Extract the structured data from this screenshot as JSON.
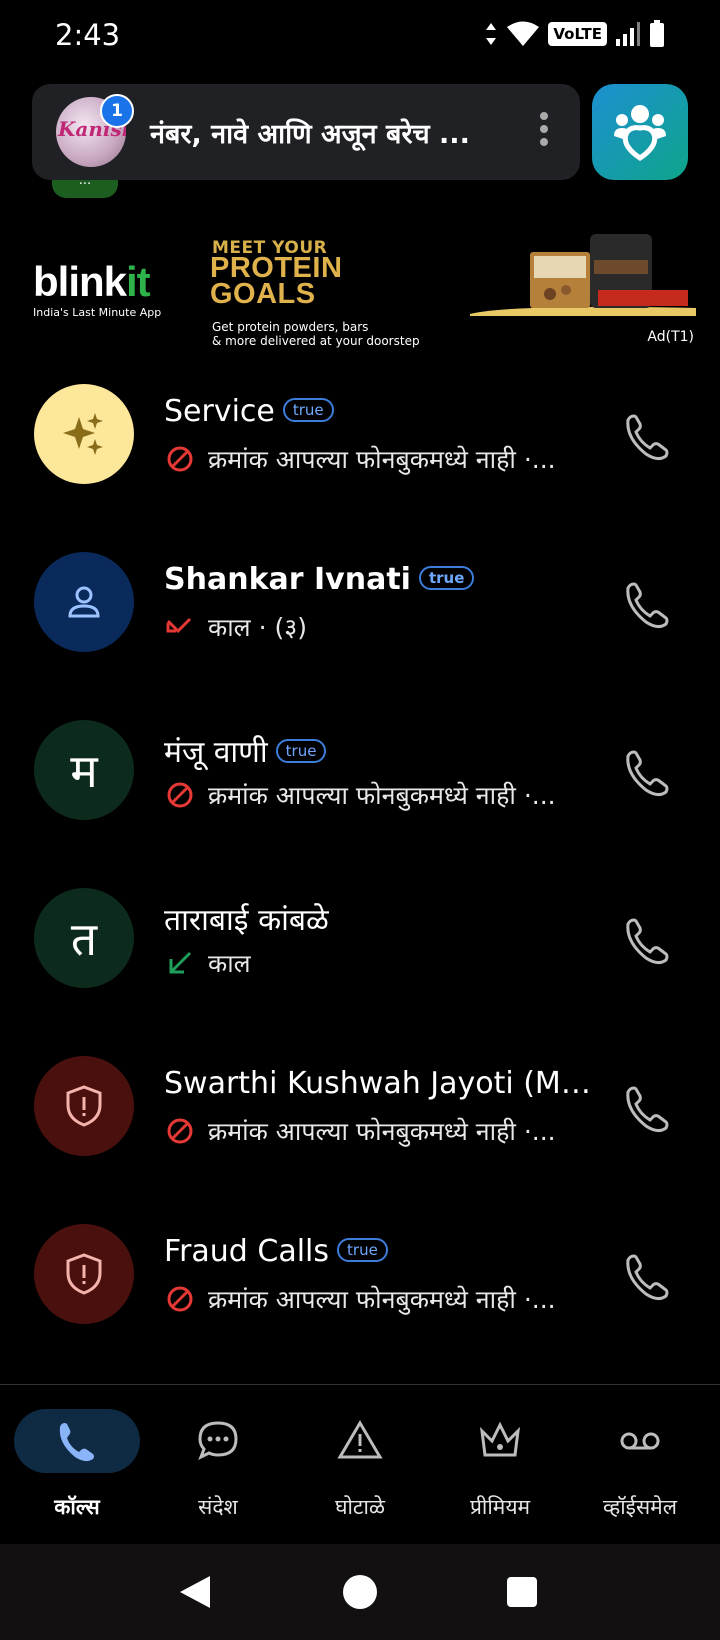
{
  "status": {
    "time": "2:43",
    "volte": "VoLTE"
  },
  "search": {
    "text": "नंबर, नावे आणि अजून बरेच ...",
    "avatar_text": "Kanishka",
    "notification_count": "1"
  },
  "ad": {
    "brand": "blink",
    "brand_suffix": "it",
    "tagline": "India's Last Minute App",
    "headline_small": "MEET YOUR",
    "headline_1": "PROTEIN",
    "headline_2": "GOALS",
    "sub_1": "Get protein powders, bars",
    "sub_2": "& more delivered at your doorstep",
    "label": "Ad(T1)"
  },
  "calls": [
    {
      "name": "Service",
      "badge": "true",
      "sub": "क्रमांक आपल्या फोनबुकमध्ये नाही ·...",
      "avatar": "",
      "avatar_color": "#fde79a",
      "sub_type": "blocked",
      "bold": false
    },
    {
      "name": "Shankar Ivnati",
      "badge": "true",
      "sub": "काल · (३)",
      "avatar": "",
      "avatar_color": "#0b2a5c",
      "sub_type": "missed",
      "bold": true
    },
    {
      "name": "मंजू वाणी",
      "badge": "true",
      "sub": "क्रमांक आपल्या फोनबुकमध्ये नाही ·...",
      "avatar": "म",
      "avatar_color": "#0c2b1c",
      "sub_type": "blocked",
      "bold": false
    },
    {
      "name": "ताराबाई कांबळे",
      "badge": "",
      "sub": "काल",
      "avatar": "त",
      "avatar_color": "#0c2b1c",
      "sub_type": "incoming",
      "bold": false
    },
    {
      "name": "Swarthi Kushwah Jayoti (Mu...",
      "badge": "",
      "sub": "क्रमांक आपल्या फोनबुकमध्ये नाही ·...",
      "avatar": "",
      "avatar_color": "#4a100d",
      "sub_type": "blocked",
      "bold": false
    },
    {
      "name": "Fraud Calls",
      "badge": "true",
      "sub": "क्रमांक आपल्या फोनबुकमध्ये नाही ·...",
      "avatar": "",
      "avatar_color": "#4a100d",
      "sub_type": "blocked",
      "bold": false
    }
  ],
  "nav": {
    "calls": "कॉल्स",
    "messages": "संदेश",
    "scams": "घोटाळे",
    "premium": "प्रीमियम",
    "voicemail": "व्हॉईसमेल"
  },
  "colors": {
    "accent": "#1a73e8",
    "blocked_red": "#e53935",
    "incoming_green": "#1e9e5a",
    "nav_active_pill": "#0f2a43"
  }
}
